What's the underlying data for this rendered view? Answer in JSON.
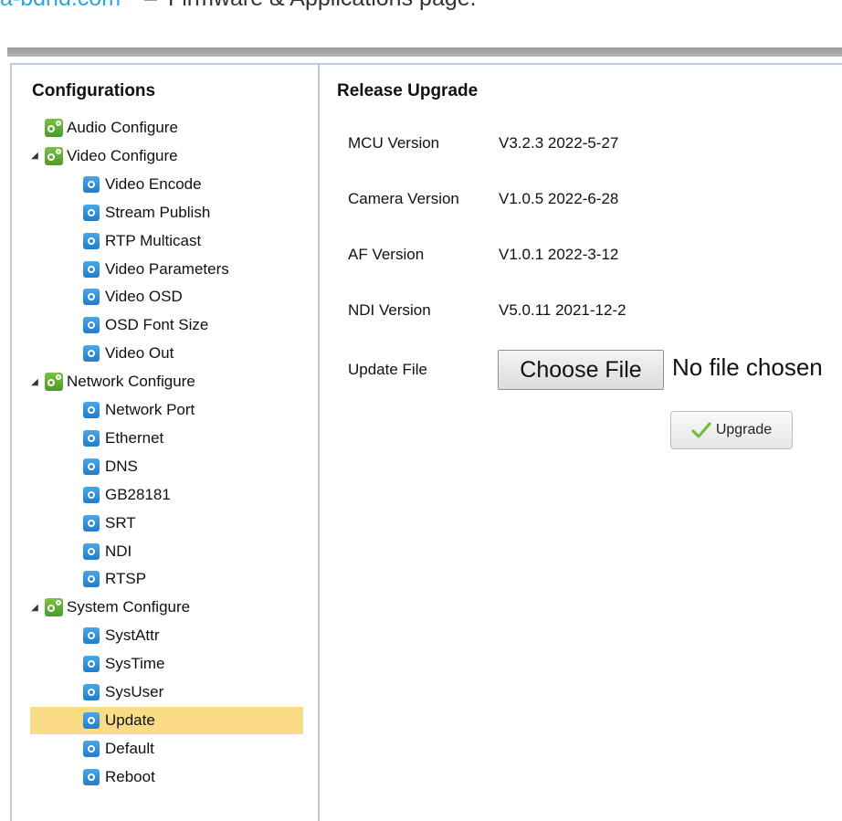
{
  "caption": {
    "link_text": "a-bdhd.com",
    "title": "Firmware & Applications page."
  },
  "sidebar": {
    "title": "Configurations",
    "items": [
      {
        "label": "Audio Configure",
        "level": 0,
        "type": "group",
        "expanded": false,
        "icon": "gear-icon"
      },
      {
        "label": "Video Configure",
        "level": 0,
        "type": "group",
        "expanded": true,
        "icon": "gear-icon"
      },
      {
        "label": "Video Encode",
        "level": 1,
        "type": "leaf",
        "icon": "settings-icon"
      },
      {
        "label": "Stream Publish",
        "level": 1,
        "type": "leaf",
        "icon": "settings-icon"
      },
      {
        "label": "RTP Multicast",
        "level": 1,
        "type": "leaf",
        "icon": "settings-icon"
      },
      {
        "label": "Video Parameters",
        "level": 1,
        "type": "leaf",
        "icon": "settings-icon"
      },
      {
        "label": "Video OSD",
        "level": 1,
        "type": "leaf",
        "icon": "settings-icon"
      },
      {
        "label": "OSD Font Size",
        "level": 1,
        "type": "leaf",
        "icon": "settings-icon"
      },
      {
        "label": "Video Out",
        "level": 1,
        "type": "leaf",
        "icon": "settings-icon"
      },
      {
        "label": "Network Configure",
        "level": 0,
        "type": "group",
        "expanded": true,
        "icon": "gear-icon"
      },
      {
        "label": "Network Port",
        "level": 1,
        "type": "leaf",
        "icon": "settings-icon"
      },
      {
        "label": "Ethernet",
        "level": 1,
        "type": "leaf",
        "icon": "settings-icon"
      },
      {
        "label": "DNS",
        "level": 1,
        "type": "leaf",
        "icon": "settings-icon"
      },
      {
        "label": "GB28181",
        "level": 1,
        "type": "leaf",
        "icon": "settings-icon"
      },
      {
        "label": "SRT",
        "level": 1,
        "type": "leaf",
        "icon": "settings-icon"
      },
      {
        "label": "NDI",
        "level": 1,
        "type": "leaf",
        "icon": "settings-icon"
      },
      {
        "label": "RTSP",
        "level": 1,
        "type": "leaf",
        "icon": "settings-icon"
      },
      {
        "label": "System Configure",
        "level": 0,
        "type": "group",
        "expanded": true,
        "icon": "gear-icon"
      },
      {
        "label": "SystAttr",
        "level": 1,
        "type": "leaf",
        "icon": "settings-icon"
      },
      {
        "label": "SysTime",
        "level": 1,
        "type": "leaf",
        "icon": "settings-icon"
      },
      {
        "label": "SysUser",
        "level": 1,
        "type": "leaf",
        "icon": "settings-icon"
      },
      {
        "label": "Update",
        "level": 1,
        "type": "leaf",
        "icon": "settings-icon",
        "selected": true
      },
      {
        "label": "Default",
        "level": 1,
        "type": "leaf",
        "icon": "settings-icon"
      },
      {
        "label": "Reboot",
        "level": 1,
        "type": "leaf",
        "icon": "settings-icon"
      }
    ]
  },
  "main": {
    "title": "Release Upgrade",
    "rows": [
      {
        "label": "MCU Version",
        "value": "V3.2.3 2022-5-27"
      },
      {
        "label": "Camera Version",
        "value": "V1.0.5 2022-6-28"
      },
      {
        "label": "AF Version",
        "value": "V1.0.1 2022-3-12"
      },
      {
        "label": "NDI Version",
        "value": "V5.0.11 2021-12-2"
      }
    ],
    "update_file": {
      "label": "Update File",
      "button_label": "Choose File",
      "status": "No file chosen"
    },
    "upgrade_button": {
      "label": "Upgrade",
      "icon": "checkmark-icon"
    }
  },
  "colors": {
    "selected_background": "#fbdc86",
    "group_icon": "#5aa832",
    "leaf_icon": "#2d8ad6",
    "panel_border": "#b9cde2",
    "caption_link": "#29a8df"
  }
}
